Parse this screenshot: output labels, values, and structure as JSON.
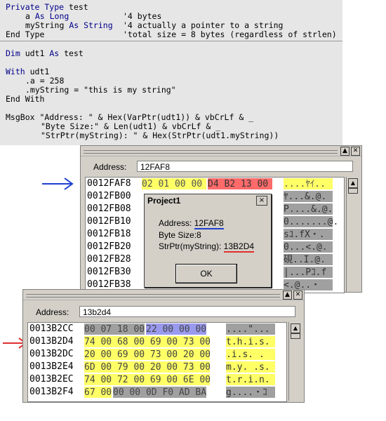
{
  "code": {
    "type_line": [
      "Private Type",
      " test"
    ],
    "field_a": [
      "a",
      " As Long",
      "'4 bytes"
    ],
    "field_s": [
      "myString",
      " As String",
      "'4 actually a pointer to a string"
    ],
    "end_type": [
      "End Type",
      "'total size = 8 bytes (regardless of strlen)"
    ],
    "dim_line": [
      "Dim",
      " udt1 ",
      "As",
      " test"
    ],
    "with_line": [
      "With",
      " udt1"
    ],
    "assign_a": ".a = 258",
    "assign_s": ".myString = \"this is my string\"",
    "end_with": "End With",
    "msgbox1": "MsgBox \"Address: \" & Hex(VarPtr(udt1)) & vbCrLf & _",
    "msgbox2": "\"Byte Size:\" & Len(udt1) & vbCrLf & _",
    "msgbox3": "\"StrPtr(myString): \" & Hex(StrPtr(udt1.myString))"
  },
  "viewer1": {
    "address_label": "Address:",
    "address_value": "12FAF8",
    "arrow": "→",
    "rows": [
      {
        "addr": "0012FAF8",
        "hex_y": "02 01 00 00",
        "hex_r": "D4 B2 13 00",
        "ascii": "....ﾔｲ.."
      },
      {
        "addr": "0012FB00",
        "hex_y": "",
        "hex_r": "",
        "ascii": "ﾔ...&.@."
      },
      {
        "addr": "0012FB08",
        "hex_y": "",
        "hex_r": "",
        "ascii": "P....&.@."
      },
      {
        "addr": "0012FB10",
        "hex_y": "",
        "hex_r": "",
        "ascii": "0.......@."
      },
      {
        "addr": "0012FB18",
        "hex_y": "",
        "hex_r": "",
        "ascii": "sﾕ.fX・."
      },
      {
        "addr": "0012FB20",
        "hex_y": "",
        "hex_r": "",
        "ascii": "0...<.@."
      },
      {
        "addr": "0012FB28",
        "hex_y": "",
        "hex_r": "",
        "ascii": "硯..I.@."
      },
      {
        "addr": "0012FB30",
        "hex_y": "",
        "hex_r": "",
        "ascii": "|...Pｺ.f"
      },
      {
        "addr": "0012FB38",
        "hex_y": "",
        "hex_r": "",
        "ascii": "<.@..・"
      }
    ]
  },
  "dialog": {
    "title": "Project1",
    "close": "×",
    "address_label": "Address: ",
    "address_value": "12FAF8",
    "size_line": "Byte Size:8",
    "strptr_label": "StrPtr(myString): ",
    "strptr_value": "13B2D4",
    "ok": "OK"
  },
  "viewer2": {
    "address_label": "Address:",
    "address_value": "13b2d4",
    "arrow": "→",
    "rows": [
      {
        "addr": "0013B2CC",
        "segs": [
          [
            "g",
            "00 07 18 00"
          ],
          [
            "b",
            "22 00 00 00"
          ]
        ],
        "ascii": "....\"..."
      },
      {
        "addr": "0013B2D4",
        "segs": [
          [
            "y",
            "74 00 68 00 69 00 73 00"
          ]
        ],
        "ascii": "t.h.i.s."
      },
      {
        "addr": "0013B2DC",
        "segs": [
          [
            "y",
            "20 00 69 00 73 00 20 00"
          ]
        ],
        "ascii": ".i.s. ."
      },
      {
        "addr": "0013B2E4",
        "segs": [
          [
            "y",
            "6D 00 79 00 20 00 73 00"
          ]
        ],
        "ascii": "m.y. .s."
      },
      {
        "addr": "0013B2EC",
        "segs": [
          [
            "y",
            "74 00 72 00 69 00 6E 00"
          ]
        ],
        "ascii": "t.r.i.n."
      },
      {
        "addr": "0013B2F4",
        "segs": [
          [
            "y",
            "67 00"
          ],
          [
            "g",
            "00 00 0D F0 AD BA"
          ]
        ],
        "ascii": "g....・ｺ"
      }
    ]
  },
  "colors": {
    "arrow1": "#1f3fd0",
    "arrow2": "#e03030",
    "yellow": "#ffff66",
    "red": "#ff6a6a",
    "blue": "#9999ee",
    "gray": "#a0a0a0"
  }
}
